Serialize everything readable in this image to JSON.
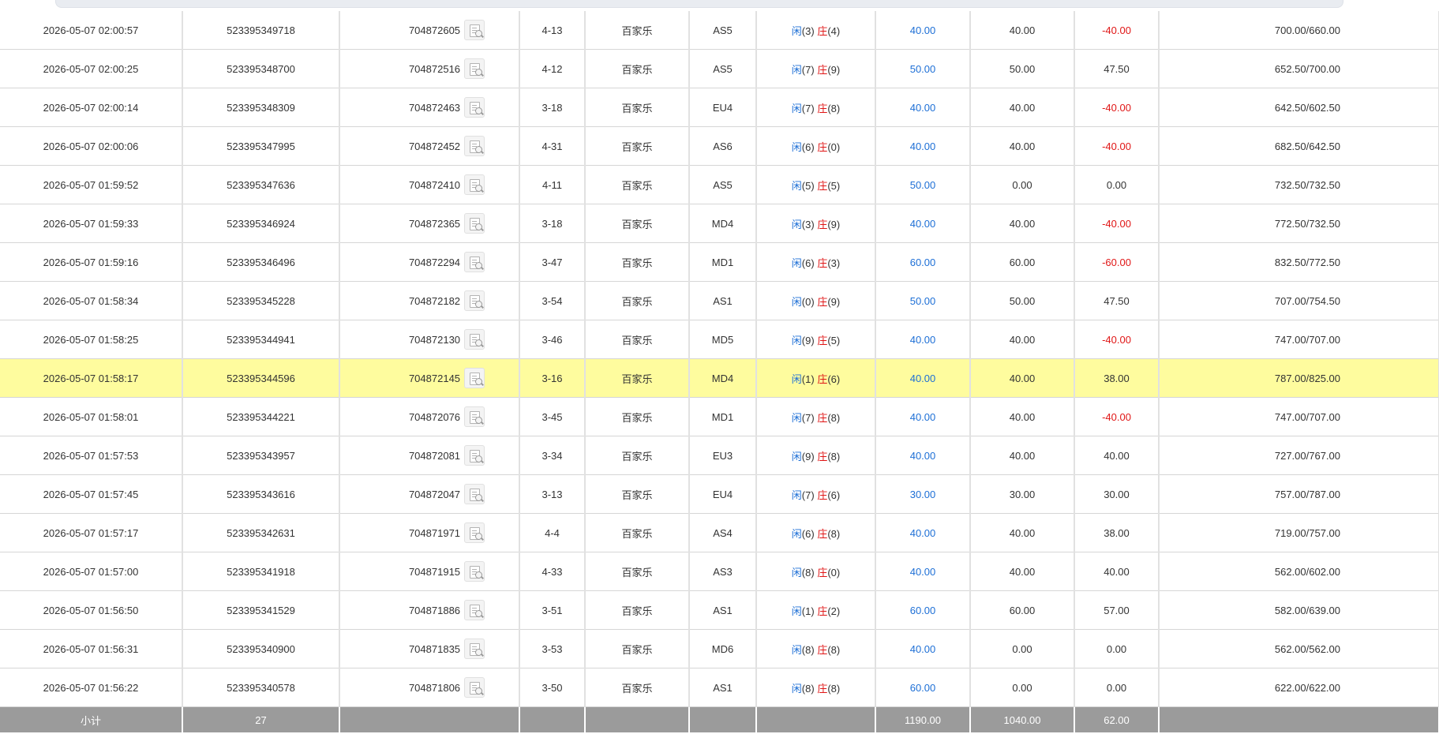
{
  "colors": {
    "player": "#1d6fd6",
    "banker": "#e01616",
    "bet": "#1d6fd6",
    "loss": "#e01616",
    "highlight_row": "#fefc9e",
    "subtotal_bg": "#9b9b9b"
  },
  "icons": {
    "detail": "document-search-icon"
  },
  "labels": {
    "player": "闲",
    "banker": "庄"
  },
  "rows": [
    {
      "time": "2026-05-07 02:00:57",
      "order": "523395349718",
      "round": "704872605",
      "shoe": "4-13",
      "game": "百家乐",
      "table": "AS5",
      "p": "(3)",
      "b": "(4)",
      "bet": "40.00",
      "valid": "40.00",
      "win": "-40.00",
      "loss": true,
      "balance": "700.00/660.00"
    },
    {
      "time": "2026-05-07 02:00:25",
      "order": "523395348700",
      "round": "704872516",
      "shoe": "4-12",
      "game": "百家乐",
      "table": "AS5",
      "p": "(7)",
      "b": "(9)",
      "bet": "50.00",
      "valid": "50.00",
      "win": "47.50",
      "loss": false,
      "balance": "652.50/700.00"
    },
    {
      "time": "2026-05-07 02:00:14",
      "order": "523395348309",
      "round": "704872463",
      "shoe": "3-18",
      "game": "百家乐",
      "table": "EU4",
      "p": "(7)",
      "b": "(8)",
      "bet": "40.00",
      "valid": "40.00",
      "win": "-40.00",
      "loss": true,
      "balance": "642.50/602.50"
    },
    {
      "time": "2026-05-07 02:00:06",
      "order": "523395347995",
      "round": "704872452",
      "shoe": "4-31",
      "game": "百家乐",
      "table": "AS6",
      "p": "(6)",
      "b": "(0)",
      "bet": "40.00",
      "valid": "40.00",
      "win": "-40.00",
      "loss": true,
      "balance": "682.50/642.50"
    },
    {
      "time": "2026-05-07 01:59:52",
      "order": "523395347636",
      "round": "704872410",
      "shoe": "4-11",
      "game": "百家乐",
      "table": "AS5",
      "p": "(5)",
      "b": "(5)",
      "bet": "50.00",
      "valid": "0.00",
      "win": "0.00",
      "loss": false,
      "balance": "732.50/732.50"
    },
    {
      "time": "2026-05-07 01:59:33",
      "order": "523395346924",
      "round": "704872365",
      "shoe": "3-18",
      "game": "百家乐",
      "table": "MD4",
      "p": "(3)",
      "b": "(9)",
      "bet": "40.00",
      "valid": "40.00",
      "win": "-40.00",
      "loss": true,
      "balance": "772.50/732.50"
    },
    {
      "time": "2026-05-07 01:59:16",
      "order": "523395346496",
      "round": "704872294",
      "shoe": "3-47",
      "game": "百家乐",
      "table": "MD1",
      "p": "(6)",
      "b": "(3)",
      "bet": "60.00",
      "valid": "60.00",
      "win": "-60.00",
      "loss": true,
      "balance": "832.50/772.50"
    },
    {
      "time": "2026-05-07 01:58:34",
      "order": "523395345228",
      "round": "704872182",
      "shoe": "3-54",
      "game": "百家乐",
      "table": "AS1",
      "p": "(0)",
      "b": "(9)",
      "bet": "50.00",
      "valid": "50.00",
      "win": "47.50",
      "loss": false,
      "balance": "707.00/754.50"
    },
    {
      "time": "2026-05-07 01:58:25",
      "order": "523395344941",
      "round": "704872130",
      "shoe": "3-46",
      "game": "百家乐",
      "table": "MD5",
      "p": "(9)",
      "b": "(5)",
      "bet": "40.00",
      "valid": "40.00",
      "win": "-40.00",
      "loss": true,
      "balance": "747.00/707.00"
    },
    {
      "time": "2026-05-07 01:58:17",
      "order": "523395344596",
      "round": "704872145",
      "shoe": "3-16",
      "game": "百家乐",
      "table": "MD4",
      "p": "(1)",
      "b": "(6)",
      "bet": "40.00",
      "valid": "40.00",
      "win": "38.00",
      "loss": false,
      "balance": "787.00/825.00",
      "highlight": true
    },
    {
      "time": "2026-05-07 01:58:01",
      "order": "523395344221",
      "round": "704872076",
      "shoe": "3-45",
      "game": "百家乐",
      "table": "MD1",
      "p": "(7)",
      "b": "(8)",
      "bet": "40.00",
      "valid": "40.00",
      "win": "-40.00",
      "loss": true,
      "balance": "747.00/707.00"
    },
    {
      "time": "2026-05-07 01:57:53",
      "order": "523395343957",
      "round": "704872081",
      "shoe": "3-34",
      "game": "百家乐",
      "table": "EU3",
      "p": "(9)",
      "b": "(8)",
      "bet": "40.00",
      "valid": "40.00",
      "win": "40.00",
      "loss": false,
      "balance": "727.00/767.00"
    },
    {
      "time": "2026-05-07 01:57:45",
      "order": "523395343616",
      "round": "704872047",
      "shoe": "3-13",
      "game": "百家乐",
      "table": "EU4",
      "p": "(7)",
      "b": "(6)",
      "bet": "30.00",
      "valid": "30.00",
      "win": "30.00",
      "loss": false,
      "balance": "757.00/787.00"
    },
    {
      "time": "2026-05-07 01:57:17",
      "order": "523395342631",
      "round": "704871971",
      "shoe": "4-4",
      "game": "百家乐",
      "table": "AS4",
      "p": "(6)",
      "b": "(8)",
      "bet": "40.00",
      "valid": "40.00",
      "win": "38.00",
      "loss": false,
      "balance": "719.00/757.00"
    },
    {
      "time": "2026-05-07 01:57:00",
      "order": "523395341918",
      "round": "704871915",
      "shoe": "4-33",
      "game": "百家乐",
      "table": "AS3",
      "p": "(8)",
      "b": "(0)",
      "bet": "40.00",
      "valid": "40.00",
      "win": "40.00",
      "loss": false,
      "balance": "562.00/602.00"
    },
    {
      "time": "2026-05-07 01:56:50",
      "order": "523395341529",
      "round": "704871886",
      "shoe": "3-51",
      "game": "百家乐",
      "table": "AS1",
      "p": "(1)",
      "b": "(2)",
      "bet": "60.00",
      "valid": "60.00",
      "win": "57.00",
      "loss": false,
      "balance": "582.00/639.00"
    },
    {
      "time": "2026-05-07 01:56:31",
      "order": "523395340900",
      "round": "704871835",
      "shoe": "3-53",
      "game": "百家乐",
      "table": "MD6",
      "p": "(8)",
      "b": "(8)",
      "bet": "40.00",
      "valid": "0.00",
      "win": "0.00",
      "loss": false,
      "balance": "562.00/562.00"
    },
    {
      "time": "2026-05-07 01:56:22",
      "order": "523395340578",
      "round": "704871806",
      "shoe": "3-50",
      "game": "百家乐",
      "table": "AS1",
      "p": "(8)",
      "b": "(8)",
      "bet": "60.00",
      "valid": "0.00",
      "win": "0.00",
      "loss": false,
      "balance": "622.00/622.00"
    }
  ],
  "subtotal": {
    "label": "小计",
    "count": "27",
    "bet": "1190.00",
    "valid": "1040.00",
    "win": "62.00"
  }
}
